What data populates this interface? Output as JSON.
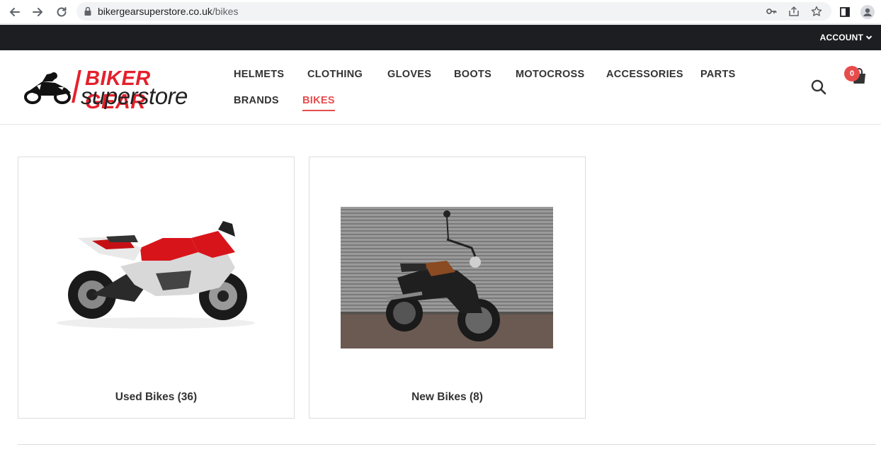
{
  "browser": {
    "url_host": "bikergearsuperstore.co.uk",
    "url_path": "/bikes"
  },
  "topbar": {
    "account_label": "ACCOUNT"
  },
  "logo": {
    "line1": "BIKER GEAR",
    "line2": "superstore"
  },
  "nav": {
    "items": [
      {
        "label": "HELMETS"
      },
      {
        "label": "CLOTHING"
      },
      {
        "label": "GLOVES"
      },
      {
        "label": "BOOTS"
      },
      {
        "label": "MOTOCROSS"
      },
      {
        "label": "ACCESSORIES"
      },
      {
        "label": "PARTS"
      },
      {
        "label": "BRANDS"
      },
      {
        "label": "BIKES"
      }
    ],
    "active": "BIKES"
  },
  "cart": {
    "count": "0"
  },
  "categories": [
    {
      "label": "Used Bikes (36)"
    },
    {
      "label": "New Bikes (8)"
    }
  ],
  "colors": {
    "accent": "#e74c4c",
    "topbar": "#1c1e21",
    "brand_red": "#e5202b"
  }
}
